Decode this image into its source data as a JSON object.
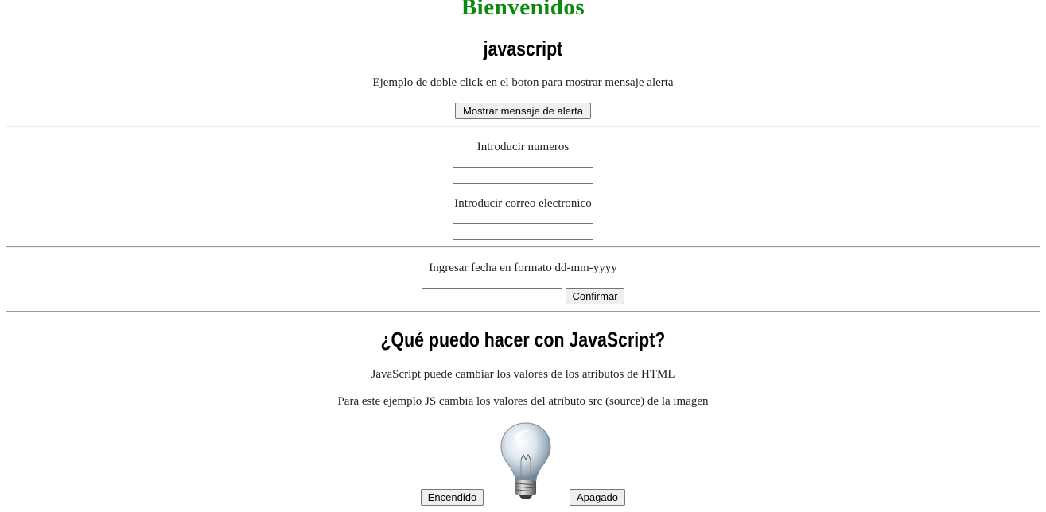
{
  "page": {
    "title": "Bienvenidos",
    "title_color": "#0a8a0a"
  },
  "section_alert": {
    "heading": "javascript",
    "description": "Ejemplo de doble click en el boton para mostrar mensaje alerta",
    "button_label": "Mostrar mensaje de alerta"
  },
  "section_inputs": {
    "numbers_label": "Introducir numeros",
    "numbers_value": "",
    "email_label": "Introducir correo electronico",
    "email_value": ""
  },
  "section_date": {
    "label": "Ingresar fecha en formato dd-mm-yyyy",
    "date_value": "",
    "confirm_label": "Confirmar"
  },
  "section_bulb": {
    "heading": "¿Qué puedo hacer con JavaScript?",
    "line1": "JavaScript puede cambiar los valores de los atributos de HTML",
    "line2": "Para este ejemplo JS cambia los valores del atributo src (source) de la imagen",
    "on_label": "Encendido",
    "off_label": "Apagado",
    "bulb_icon": "lightbulb-off-icon"
  }
}
